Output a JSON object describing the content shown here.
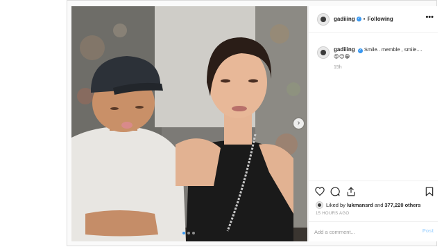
{
  "post": {
    "author": "gadiiing",
    "header_separator": "•",
    "follow_status": "Following",
    "more_label": "•••",
    "caption_text": "Smile.. memble , smile....",
    "caption_emojis": "😜😑😁",
    "caption_time": "15h",
    "liked_prefix": "Liked by",
    "liked_user": "lukmansrd",
    "liked_and": "and",
    "likes_count": "377,220 others",
    "timestamp": "15 HOURS AGO",
    "comment_placeholder": "Add a comment...",
    "post_label": "Post",
    "carousel_next_glyph": "›",
    "carousel_total": 3,
    "carousel_current": 1
  },
  "icons": [
    "heart-icon",
    "comment-icon",
    "share-icon",
    "bookmark-icon",
    "verified-icon",
    "more-icon",
    "chevron-right-icon"
  ],
  "colors": {
    "accent": "#3897f0",
    "post_disabled": "#b3dbff",
    "muted_text": "#999999",
    "border": "#efefef"
  }
}
